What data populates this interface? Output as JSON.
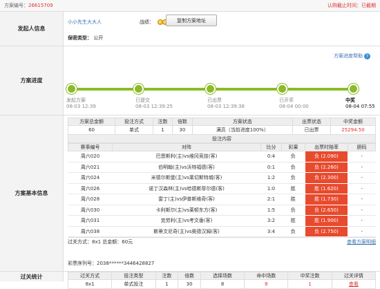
{
  "topbar": {
    "id_label": "方案编号：",
    "id_value": "26615709",
    "deadline": "认购截止时间：已截期"
  },
  "sponsor": {
    "label": "发起人信息",
    "name": "小小先生大大人",
    "record_label": "战绩：",
    "copy_button": "复制方案地址",
    "secrecy_label": "保密类型：",
    "secrecy_value": "公开"
  },
  "progress": {
    "label": "方案进度",
    "help": "方案进度帮助",
    "help_icon": "?",
    "steps": [
      {
        "name": "发起方案",
        "time": "08-03 12:39"
      },
      {
        "name": "已提交",
        "time": "08-03 12:39:25"
      },
      {
        "name": "已出票",
        "time": "08-03 12:39:38"
      },
      {
        "name": "已开奖",
        "time": "08-04 00:00"
      },
      {
        "name": "中奖",
        "time": "08-04 07:55"
      }
    ]
  },
  "basic": {
    "label": "方案基本信息",
    "summary_headers": [
      "方案总金额",
      "投注方式",
      "注数",
      "倍数",
      "方案状态",
      "出票状态",
      "中奖金额"
    ],
    "summary_row": [
      "60",
      "单式",
      "1",
      "30",
      "满员（当前进度100%）",
      "已出票",
      "25294.50"
    ],
    "bet_section_title": "投注内容",
    "match_headers": [
      "赛事编号",
      "对阵",
      "比分",
      "彩果",
      "出票时赔率",
      "胆码"
    ],
    "matches": [
      {
        "id": "周六020",
        "against": "巴恩斯利(主)vs维冈竞技(客)",
        "score": "0:4",
        "result": "负",
        "odds": "负 (2.090)",
        "banker": "-"
      },
      {
        "id": "周六021",
        "against": "伯明翰(主)vs沃特福德(客)",
        "score": "0:1",
        "result": "负",
        "odds": "负 (2.260)",
        "banker": "-"
      },
      {
        "id": "周六024",
        "against": "米德尔斯堡(主)vs莱切斯特城(客)",
        "score": "1:2",
        "result": "负",
        "odds": "负 (2.300)",
        "banker": "-"
      },
      {
        "id": "周六026",
        "against": "诺丁汉森林(主)vs哈德斯菲尔德(客)",
        "score": "1:0",
        "result": "胜",
        "odds": "胜 (1.620)",
        "banker": "-"
      },
      {
        "id": "周六028",
        "against": "雷丁(主)vs伊普斯维奇(客)",
        "score": "2:1",
        "result": "胜",
        "odds": "胜 (1.730)",
        "banker": "-"
      },
      {
        "id": "周六030",
        "against": "卡利斯尔(主)vs莱顿东方(客)",
        "score": "1:5",
        "result": "负",
        "odds": "负 (2.650)",
        "banker": "-"
      },
      {
        "id": "周六031",
        "against": "克劳利(主)vs考文垂(客)",
        "score": "3:2",
        "result": "胜",
        "odds": "胜 (1.900)",
        "banker": "-"
      },
      {
        "id": "周六038",
        "against": "斯蒂文尼奇(主)vs奥德汉姆(客)",
        "score": "3:4",
        "result": "负",
        "odds": "负 (2.750)",
        "banker": "-"
      }
    ],
    "pass_info": "过关方式：8x1 总金额：60元",
    "view_detail": "查看方案明细",
    "serial_label": "彩票序列号：",
    "serial_value": "2038******3446428827"
  },
  "pass": {
    "label": "过关统计",
    "headers": [
      "过关方式",
      "投注类型",
      "注数",
      "倍数",
      "选择场数",
      "命中场数",
      "中奖注数",
      "过关详情"
    ],
    "row": [
      "8x1",
      "单式投注",
      "1",
      "30",
      "8",
      "8",
      "1",
      "查看"
    ]
  }
}
